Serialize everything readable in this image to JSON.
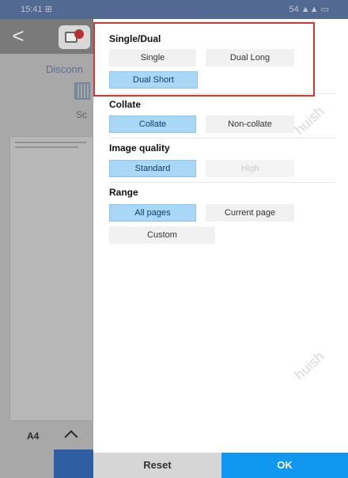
{
  "status": {
    "time": "15:41 ⊞",
    "indicators": "54 ▲▲ ▭"
  },
  "background": {
    "connection_status": "Disconn",
    "scan_label": "Sc",
    "paper_size": "A4"
  },
  "sections": {
    "single_dual": {
      "title": "Single/Dual",
      "options": [
        "Single",
        "Dual Long",
        "Dual Short"
      ],
      "selected": "Dual Short"
    },
    "collate": {
      "title": "Collate",
      "options": [
        "Collate",
        "Non-collate"
      ],
      "selected": "Collate"
    },
    "image_quality": {
      "title": "Image quality",
      "options": [
        "Standard",
        "High"
      ],
      "selected": "Standard",
      "disabled": "High"
    },
    "range": {
      "title": "Range",
      "options": [
        "All pages",
        "Current page",
        "Custom"
      ],
      "selected": "All pages"
    }
  },
  "footer": {
    "reset_label": "Reset",
    "ok_label": "OK"
  },
  "watermark": "huish",
  "colors": {
    "selected_bg": "#a9d7f6",
    "ok_bg": "#1098f0",
    "highlight_border": "#d73535"
  }
}
